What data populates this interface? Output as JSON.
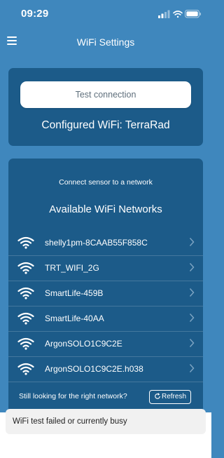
{
  "status_bar": {
    "time": "09:29"
  },
  "header": {
    "title": "WiFi Settings"
  },
  "test_card": {
    "test_button_label": "Test connection",
    "configured_text": "Configured WiFi: TerraRad"
  },
  "networks_card": {
    "hint": "Connect sensor to a network",
    "title": "Available WiFi Networks",
    "networks": [
      "shelly1pm-8CAAB55F858C",
      "TRT_WIFI_2G",
      "SmartLife-459B",
      "SmartLife-40AA",
      "ArgonSOLO1C9C2E",
      "ArgonSOLO1C9C2E.h038"
    ],
    "still_looking": "Still looking for the right network?",
    "refresh_label": "Refresh"
  },
  "toast": {
    "message": "WiFi test failed or currently busy"
  },
  "colors": {
    "background": "#3f87bd",
    "card": "#1c5b89"
  },
  "icons": [
    "menu-icon",
    "wifi-icon",
    "chevron-right-icon",
    "refresh-icon",
    "signal-icon",
    "battery-icon"
  ]
}
